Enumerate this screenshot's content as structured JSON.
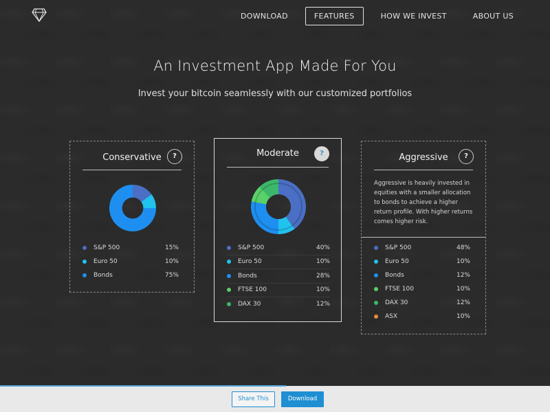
{
  "nav": {
    "items": [
      {
        "label": "DOWNLOAD",
        "active": false
      },
      {
        "label": "FEATURES",
        "active": true
      },
      {
        "label": "HOW WE INVEST",
        "active": false
      },
      {
        "label": "ABOUT US",
        "active": false
      }
    ]
  },
  "hero": {
    "title": "An Investment App Made For You",
    "subtitle": "Invest your bitcoin seamlessly with our customized portfolios"
  },
  "colors": {
    "sp500": "#4a6fc4",
    "euro50": "#22c2ee",
    "bonds": "#1e8ff0",
    "ftse": "#5ad06a",
    "dax": "#3cb86a",
    "asx": "#e88b3a",
    "accent": "#1e8fd2"
  },
  "portfolios": [
    {
      "name": "Conservative",
      "help": "?",
      "holdings": [
        {
          "name": "S&P 500",
          "value": "15%",
          "pct": 15,
          "color": "#4a6fc4"
        },
        {
          "name": "Euro 50",
          "value": "10%",
          "pct": 10,
          "color": "#22c2ee"
        },
        {
          "name": "Bonds",
          "value": "75%",
          "pct": 75,
          "color": "#1e8ff0"
        }
      ]
    },
    {
      "name": "Moderate",
      "help": "?",
      "holdings": [
        {
          "name": "S&P 500",
          "value": "40%",
          "pct": 40,
          "color": "#4a6fc4"
        },
        {
          "name": "Euro 50",
          "value": "10%",
          "pct": 10,
          "color": "#22c2ee"
        },
        {
          "name": "Bonds",
          "value": "28%",
          "pct": 28,
          "color": "#1e8ff0"
        },
        {
          "name": "FTSE 100",
          "value": "10%",
          "pct": 10,
          "color": "#5ad06a"
        },
        {
          "name": "DAX 30",
          "value": "12%",
          "pct": 12,
          "color": "#3cb86a"
        }
      ]
    },
    {
      "name": "Aggressive",
      "help": "?",
      "description": "Aggressive is heavily invested in equities with a smaller allocation to bonds to achieve a higher return profile. With higher returns comes higher risk.",
      "holdings": [
        {
          "name": "S&P 500",
          "value": "48%",
          "pct": 48,
          "color": "#4a6fc4"
        },
        {
          "name": "Euro 50",
          "value": "10%",
          "pct": 10,
          "color": "#22c2ee"
        },
        {
          "name": "Bonds",
          "value": "12%",
          "pct": 12,
          "color": "#1e8ff0"
        },
        {
          "name": "FTSE 100",
          "value": "10%",
          "pct": 10,
          "color": "#5ad06a"
        },
        {
          "name": "DAX 30",
          "value": "12%",
          "pct": 12,
          "color": "#3cb86a"
        },
        {
          "name": "ASX",
          "value": "10%",
          "pct": 10,
          "color": "#e88b3a"
        }
      ]
    }
  ],
  "footer": {
    "share_label": "Share This",
    "download_label": "Download",
    "scroll_progress": 0.52
  }
}
